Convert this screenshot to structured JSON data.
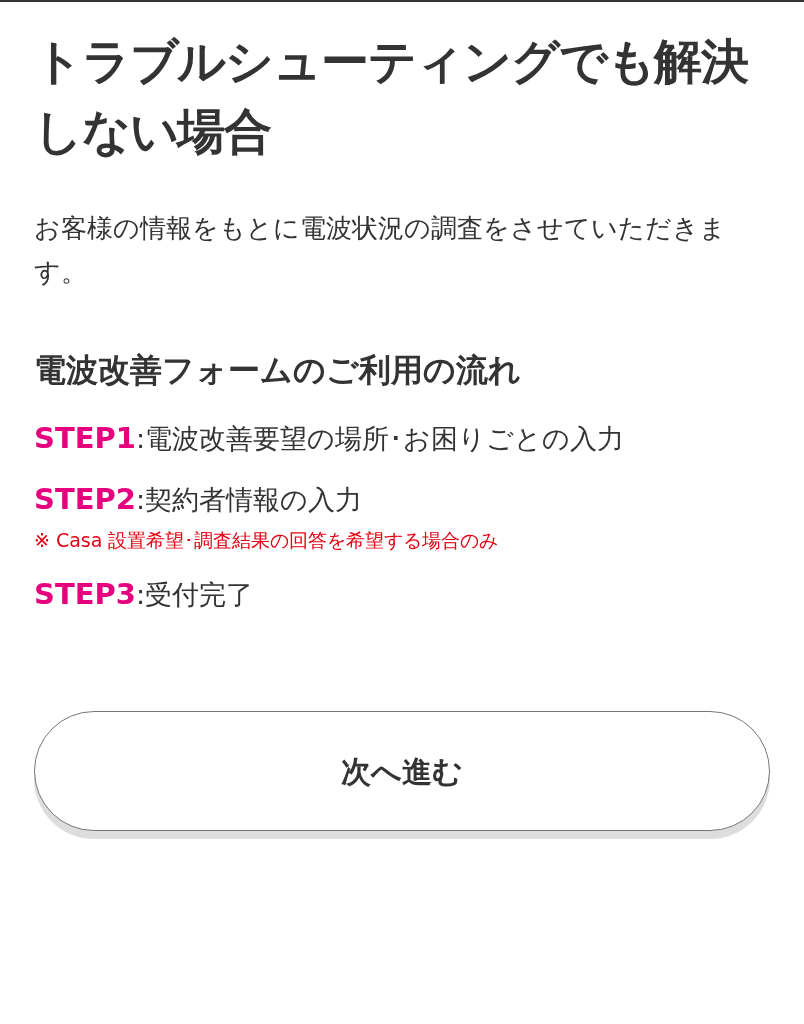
{
  "title": "トラブルシューティングでも解決しない場合",
  "description": "お客様の情報をもとに電波状況の調査をさせていただきます。",
  "flow_heading": "電波改善フォームのご利用の流れ",
  "steps": [
    {
      "label": "STEP1",
      "text": ":電波改善要望の場所･お困りごとの入力"
    },
    {
      "label": "STEP2",
      "text": ":契約者情報の入力",
      "note": "※ Casa 設置希望･調査結果の回答を希望する場合のみ"
    },
    {
      "label": "STEP3",
      "text": ":受付完了"
    }
  ],
  "button": "次へ進む"
}
